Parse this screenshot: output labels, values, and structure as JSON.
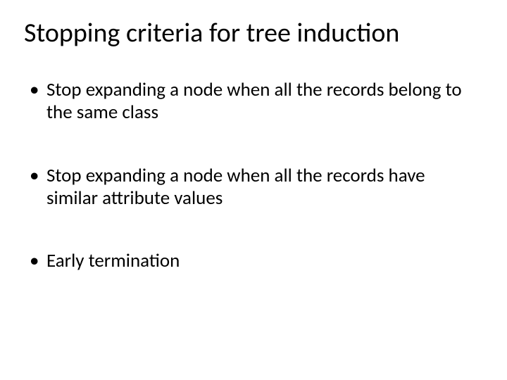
{
  "slide": {
    "title": "Stopping criteria for tree induction",
    "bullets": [
      "Stop expanding a node when all the records belong to the same class",
      "Stop expanding a node when all the records have similar attribute values",
      "Early termination"
    ]
  }
}
